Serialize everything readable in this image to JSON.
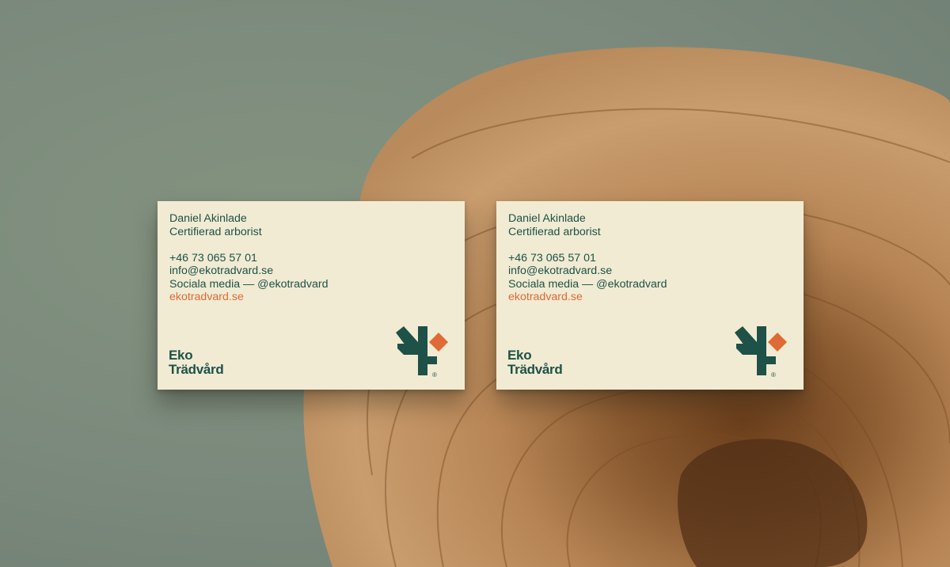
{
  "scene": {
    "description_colors": {
      "background": "#7d8c7f",
      "wood_light": "#c79a6c",
      "wood_dark": "#5a3418"
    }
  },
  "brand": {
    "colors": {
      "primary": "#1e5147",
      "accent": "#e06a35",
      "card": "#f1ebd3"
    },
    "icon": "tree-mark-icon"
  },
  "cards": [
    {
      "name": "Daniel Akinlade",
      "title": "Certifierad arborist",
      "phone": "+46 73 065 57 01",
      "email": "info@ekotradvard.se",
      "social": "Sociala media — @ekotradvard",
      "website": "ekotradvard.se",
      "wordmark_line1": "Eko",
      "wordmark_line2": "Trädvård",
      "registered": "®"
    },
    {
      "name": "Daniel Akinlade",
      "title": "Certifierad arborist",
      "phone": "+46 73 065 57 01",
      "email": "info@ekotradvard.se",
      "social": "Sociala media — @ekotradvard",
      "website": "ekotradvard.se",
      "wordmark_line1": "Eko",
      "wordmark_line2": "Trädvård",
      "registered": "®"
    }
  ]
}
